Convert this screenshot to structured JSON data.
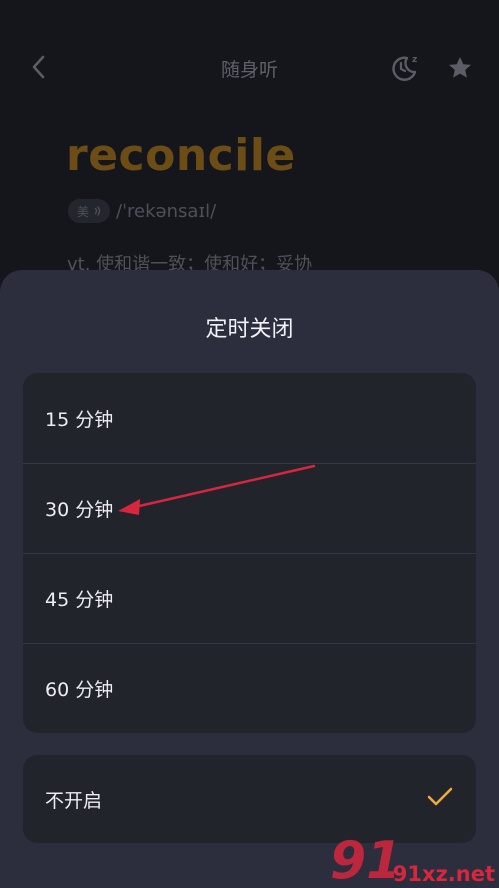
{
  "header": {
    "title": "随身听"
  },
  "entry": {
    "word": "reconcile",
    "accent_label": "美",
    "phonetic": "/ˈrekənsaɪl/",
    "definition": "vt. 使和谐一致；使和好；妥协"
  },
  "sheet": {
    "title": "定时关闭",
    "options": [
      {
        "label": "15 分钟"
      },
      {
        "label": "30 分钟"
      },
      {
        "label": "45 分钟"
      },
      {
        "label": "60 分钟"
      }
    ],
    "off_label": "不开启",
    "off_selected": true
  },
  "watermark": {
    "text": "91xz.net"
  },
  "colors": {
    "accent": "#f0a83a",
    "annotation_arrow": "#d7263d"
  },
  "icons": [
    "chevron-left-icon",
    "sleep-timer-icon",
    "star-icon",
    "speaker-icon",
    "checkmark-icon"
  ]
}
